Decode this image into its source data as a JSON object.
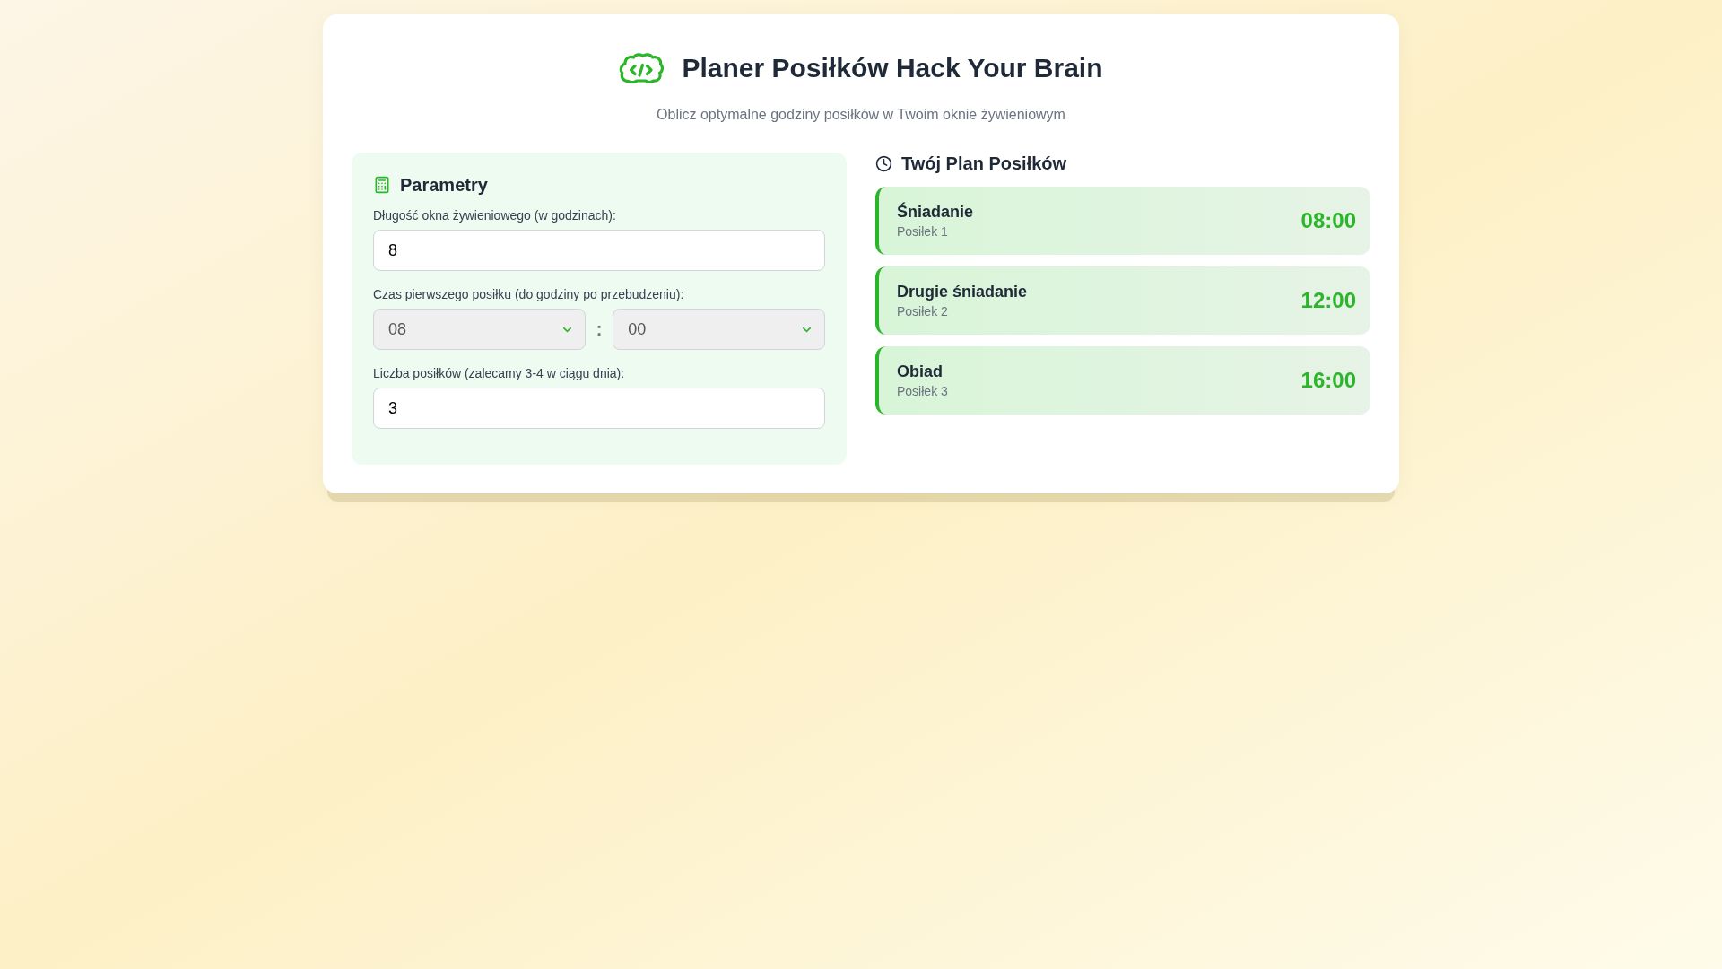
{
  "header": {
    "title": "Planer Posiłków Hack Your Brain",
    "subtitle": "Oblicz optymalne godziny posiłków w Twoim oknie żywieniowym"
  },
  "parameters": {
    "heading": "Parametry",
    "fields": [
      {
        "kind": "number",
        "label": "Długość okna żywieniowego (w godzinach):",
        "value": "8"
      },
      {
        "kind": "time",
        "label": "Czas pierwszego posiłku (do godziny po przebudzeniu):",
        "hour": "08",
        "separator": ":",
        "minute": "00"
      },
      {
        "kind": "number",
        "label": "Liczba posiłków (zalecamy 3-4 w ciągu dnia):",
        "value": "3"
      }
    ]
  },
  "plan": {
    "heading": "Twój Plan Posiłków",
    "meals": [
      {
        "name": "Śniadanie",
        "number": "Posiłek 1",
        "time": "08:00"
      },
      {
        "name": "Drugie śniadanie",
        "number": "Posiłek 2",
        "time": "12:00"
      },
      {
        "name": "Obiad",
        "number": "Posiłek 3",
        "time": "16:00"
      }
    ]
  }
}
